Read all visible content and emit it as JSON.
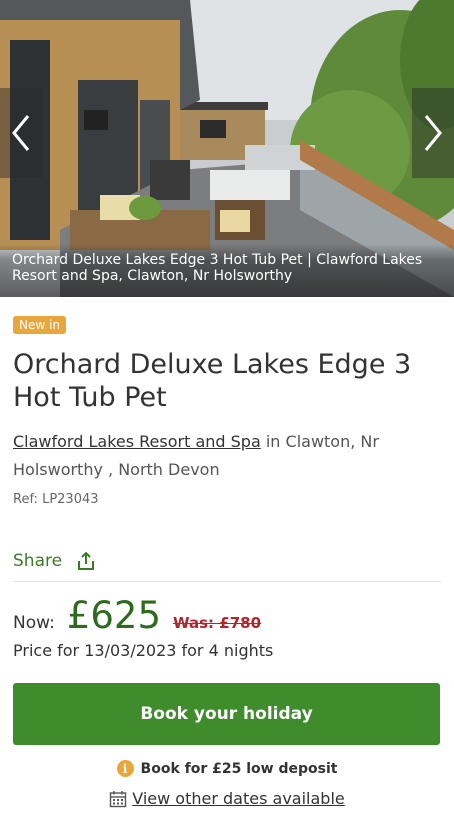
{
  "hero": {
    "caption": "Orchard Deluxe Lakes Edge 3 Hot Tub Pet | Clawford Lakes Resort and Spa, Clawton, Nr Holsworthy",
    "prev_icon": "chevron-left-icon",
    "next_icon": "chevron-right-icon"
  },
  "listing": {
    "badge": "New in",
    "title": "Orchard Deluxe Lakes Edge 3 Hot Tub Pet",
    "park_link": "Clawford Lakes Resort and Spa",
    "location_rest": " in Clawton, Nr Holsworthy , North Devon",
    "ref": "Ref: LP23043"
  },
  "share": {
    "label": "Share",
    "icon": "share-icon"
  },
  "pricing": {
    "now_label": "Now:",
    "now_price": "£625",
    "was_price": "Was: £780",
    "note": "Price for 13/03/2023 for 4 nights"
  },
  "actions": {
    "book_label": "Book your holiday",
    "deposit_icon": "info-icon",
    "deposit_text": "Book for £25 low deposit",
    "calendar_icon": "calendar-icon",
    "dates_link": "View other dates available"
  },
  "colors": {
    "brand_green": "#3f8c2d",
    "price_green": "#2f6b1f",
    "was_red": "#b3242b",
    "badge_orange": "#e9a63a"
  }
}
